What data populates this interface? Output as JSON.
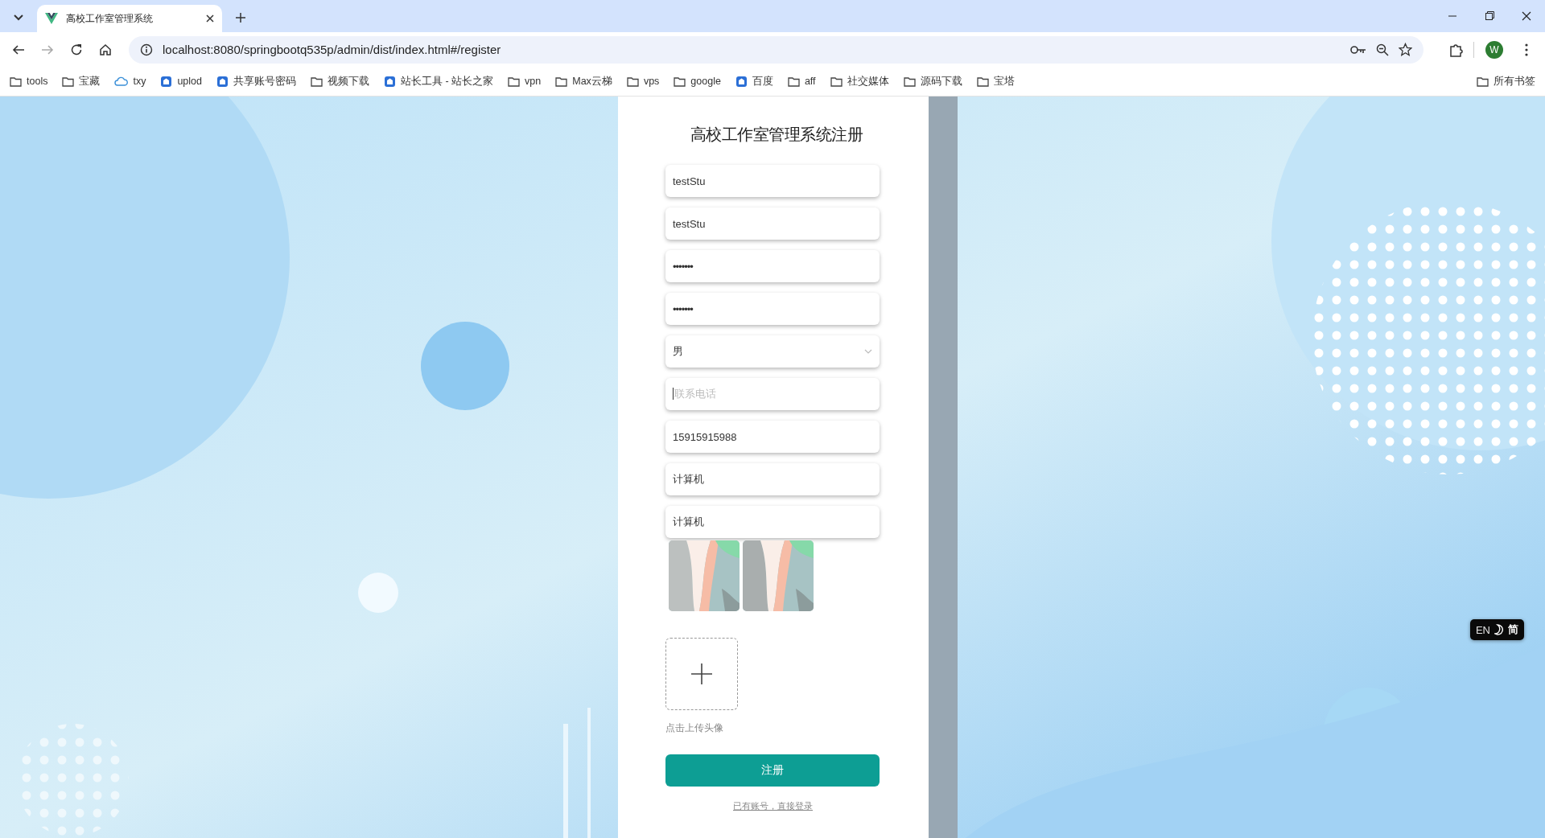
{
  "browser": {
    "tab_title": "高校工作室管理系统",
    "url": "localhost:8080/springbootq535p/admin/dist/index.html#/register",
    "profile_initial": "W",
    "bookmarks": [
      {
        "kind": "folder",
        "label": "tools"
      },
      {
        "kind": "folder",
        "label": "宝藏"
      },
      {
        "kind": "cloud",
        "label": "txy"
      },
      {
        "kind": "site",
        "label": "uplod"
      },
      {
        "kind": "site",
        "label": "共享账号密码"
      },
      {
        "kind": "folder",
        "label": "视频下载"
      },
      {
        "kind": "site",
        "label": "站长工具 - 站长之家"
      },
      {
        "kind": "folder",
        "label": "vpn"
      },
      {
        "kind": "folder",
        "label": "Max云梯"
      },
      {
        "kind": "folder",
        "label": "vps"
      },
      {
        "kind": "folder",
        "label": "google"
      },
      {
        "kind": "site",
        "label": "百度"
      },
      {
        "kind": "folder",
        "label": "aff"
      },
      {
        "kind": "folder",
        "label": "社交媒体"
      },
      {
        "kind": "folder",
        "label": "源码下载"
      },
      {
        "kind": "folder",
        "label": "宝塔"
      }
    ],
    "all_bookmarks": "所有书签"
  },
  "form": {
    "title": "高校工作室管理系统注册",
    "fields": [
      {
        "kind": "text",
        "value": "testStu"
      },
      {
        "kind": "text",
        "value": "testStu"
      },
      {
        "kind": "password",
        "value": "•••••••"
      },
      {
        "kind": "password",
        "value": "•••••••"
      },
      {
        "kind": "select",
        "value": "男"
      },
      {
        "kind": "text",
        "placeholder": "联系电话"
      },
      {
        "kind": "text",
        "value": "15915915988"
      },
      {
        "kind": "text",
        "value": "计算机"
      },
      {
        "kind": "text",
        "value": "计算机"
      }
    ],
    "upload_hint": "点击上传头像",
    "submit": "注册",
    "login_link": "已有账号，直接登录"
  },
  "lang_switch": {
    "options": [
      {
        "label": "EN",
        "selected": false
      },
      {
        "label": "简",
        "selected": true
      }
    ]
  }
}
